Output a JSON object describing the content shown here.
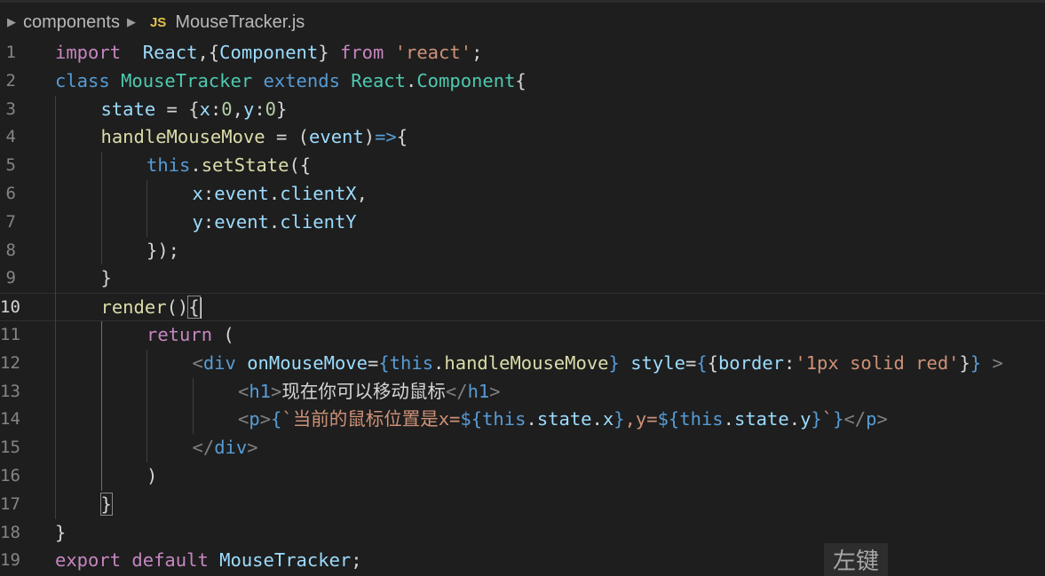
{
  "breadcrumb": {
    "folder": "components",
    "file_type_badge": "JS",
    "file": "MouseTracker.js"
  },
  "editor": {
    "active_line": 10,
    "lines": [
      {
        "n": "1",
        "indent": 0,
        "tokens": [
          [
            "kw2",
            "import"
          ],
          [
            "",
            "  "
          ],
          [
            "var",
            "React"
          ],
          [
            "",
            ",{"
          ],
          [
            "var",
            "Component"
          ],
          [
            "",
            "} "
          ],
          [
            "kw2",
            "from"
          ],
          [
            "",
            " "
          ],
          [
            "str",
            "'react'"
          ],
          [
            "",
            ";"
          ]
        ]
      },
      {
        "n": "2",
        "indent": 0,
        "tokens": [
          [
            "kw",
            "class"
          ],
          [
            "",
            " "
          ],
          [
            "cls",
            "MouseTracker"
          ],
          [
            "",
            " "
          ],
          [
            "kw",
            "extends"
          ],
          [
            "",
            " "
          ],
          [
            "cls",
            "React"
          ],
          [
            "",
            "."
          ],
          [
            "cls",
            "Component"
          ],
          [
            "",
            "{"
          ]
        ]
      },
      {
        "n": "3",
        "indent": 1,
        "tokens": [
          [
            "var",
            "state"
          ],
          [
            "",
            " = {"
          ],
          [
            "var",
            "x"
          ],
          [
            "",
            ":"
          ],
          [
            "num",
            "0"
          ],
          [
            "",
            ","
          ],
          [
            "var",
            "y"
          ],
          [
            "",
            ":"
          ],
          [
            "num",
            "0"
          ],
          [
            "",
            "}"
          ]
        ]
      },
      {
        "n": "4",
        "indent": 1,
        "tokens": [
          [
            "fn",
            "handleMouseMove"
          ],
          [
            "",
            " = ("
          ],
          [
            "var",
            "event"
          ],
          [
            "",
            ")"
          ],
          [
            "kw",
            "=>"
          ],
          [
            "",
            "{"
          ]
        ]
      },
      {
        "n": "5",
        "indent": 2,
        "tokens": [
          [
            "kw",
            "this"
          ],
          [
            "",
            "."
          ],
          [
            "fn",
            "setState"
          ],
          [
            "",
            "({"
          ]
        ]
      },
      {
        "n": "6",
        "indent": 3,
        "tokens": [
          [
            "var",
            "x"
          ],
          [
            "",
            ":"
          ],
          [
            "var",
            "event"
          ],
          [
            "",
            "."
          ],
          [
            "var",
            "clientX"
          ],
          [
            "",
            ","
          ]
        ]
      },
      {
        "n": "7",
        "indent": 3,
        "tokens": [
          [
            "var",
            "y"
          ],
          [
            "",
            ":"
          ],
          [
            "var",
            "event"
          ],
          [
            "",
            "."
          ],
          [
            "var",
            "clientY"
          ]
        ]
      },
      {
        "n": "8",
        "indent": 2,
        "tokens": [
          [
            "",
            "});"
          ]
        ]
      },
      {
        "n": "9",
        "indent": 1,
        "tokens": [
          [
            "",
            "}"
          ]
        ]
      },
      {
        "n": "10",
        "indent": 1,
        "tokens": [
          [
            "fn",
            "render"
          ],
          [
            "",
            "()"
          ],
          [
            "brk",
            "{"
          ]
        ]
      },
      {
        "n": "11",
        "indent": 2,
        "tokens": [
          [
            "kw2",
            "return"
          ],
          [
            "",
            " ("
          ]
        ]
      },
      {
        "n": "12",
        "indent": 3,
        "tokens": [
          [
            "tagb",
            "<"
          ],
          [
            "tag",
            "div"
          ],
          [
            "",
            " "
          ],
          [
            "attr",
            "onMouseMove"
          ],
          [
            "",
            "="
          ],
          [
            "kw",
            "{"
          ],
          [
            "kw",
            "this"
          ],
          [
            "",
            "."
          ],
          [
            "fn",
            "handleMouseMove"
          ],
          [
            "kw",
            "}"
          ],
          [
            "",
            " "
          ],
          [
            "attr",
            "style"
          ],
          [
            "",
            "="
          ],
          [
            "kw",
            "{"
          ],
          [
            "",
            "{"
          ],
          [
            "var",
            "border"
          ],
          [
            "",
            ":"
          ],
          [
            "str",
            "'1px solid red'"
          ],
          [
            "",
            "}"
          ],
          [
            "kw",
            "}"
          ],
          [
            "",
            " "
          ],
          [
            "tagb",
            ">"
          ]
        ]
      },
      {
        "n": "13",
        "indent": 4,
        "tokens": [
          [
            "tagb",
            "<"
          ],
          [
            "tag",
            "h1"
          ],
          [
            "tagb",
            ">"
          ],
          [
            "",
            "现在你可以移动鼠标"
          ],
          [
            "tagb",
            "</"
          ],
          [
            "tag",
            "h1"
          ],
          [
            "tagb",
            ">"
          ]
        ]
      },
      {
        "n": "14",
        "indent": 4,
        "tokens": [
          [
            "tagb",
            "<"
          ],
          [
            "tag",
            "p"
          ],
          [
            "tagb",
            ">"
          ],
          [
            "kw",
            "{"
          ],
          [
            "str",
            "`当前的鼠标位置是x="
          ],
          [
            "kw",
            "${"
          ],
          [
            "kw",
            "this"
          ],
          [
            "",
            "."
          ],
          [
            "var",
            "state"
          ],
          [
            "",
            "."
          ],
          [
            "var",
            "x"
          ],
          [
            "kw",
            "}"
          ],
          [
            "str",
            ",y="
          ],
          [
            "kw",
            "${"
          ],
          [
            "kw",
            "this"
          ],
          [
            "",
            "."
          ],
          [
            "var",
            "state"
          ],
          [
            "",
            "."
          ],
          [
            "var",
            "y"
          ],
          [
            "kw",
            "}"
          ],
          [
            "str",
            "`"
          ],
          [
            "kw",
            "}"
          ],
          [
            "tagb",
            "</"
          ],
          [
            "tag",
            "p"
          ],
          [
            "tagb",
            ">"
          ]
        ]
      },
      {
        "n": "15",
        "indent": 3,
        "tokens": [
          [
            "tagb",
            "</"
          ],
          [
            "tag",
            "div"
          ],
          [
            "tagb",
            ">"
          ]
        ]
      },
      {
        "n": "16",
        "indent": 2,
        "tokens": [
          [
            "",
            ")"
          ]
        ]
      },
      {
        "n": "17",
        "indent": 1,
        "tokens": [
          [
            "brk",
            "}"
          ]
        ]
      },
      {
        "n": "18",
        "indent": 0,
        "tokens": [
          [
            "",
            "}"
          ]
        ]
      },
      {
        "n": "19",
        "indent": 0,
        "tokens": [
          [
            "kw2",
            "export"
          ],
          [
            "",
            " "
          ],
          [
            "kw2",
            "default"
          ],
          [
            "",
            " "
          ],
          [
            "var",
            "MouseTracker"
          ],
          [
            "",
            ";"
          ]
        ]
      }
    ]
  },
  "tooltip": {
    "label": "左键"
  }
}
